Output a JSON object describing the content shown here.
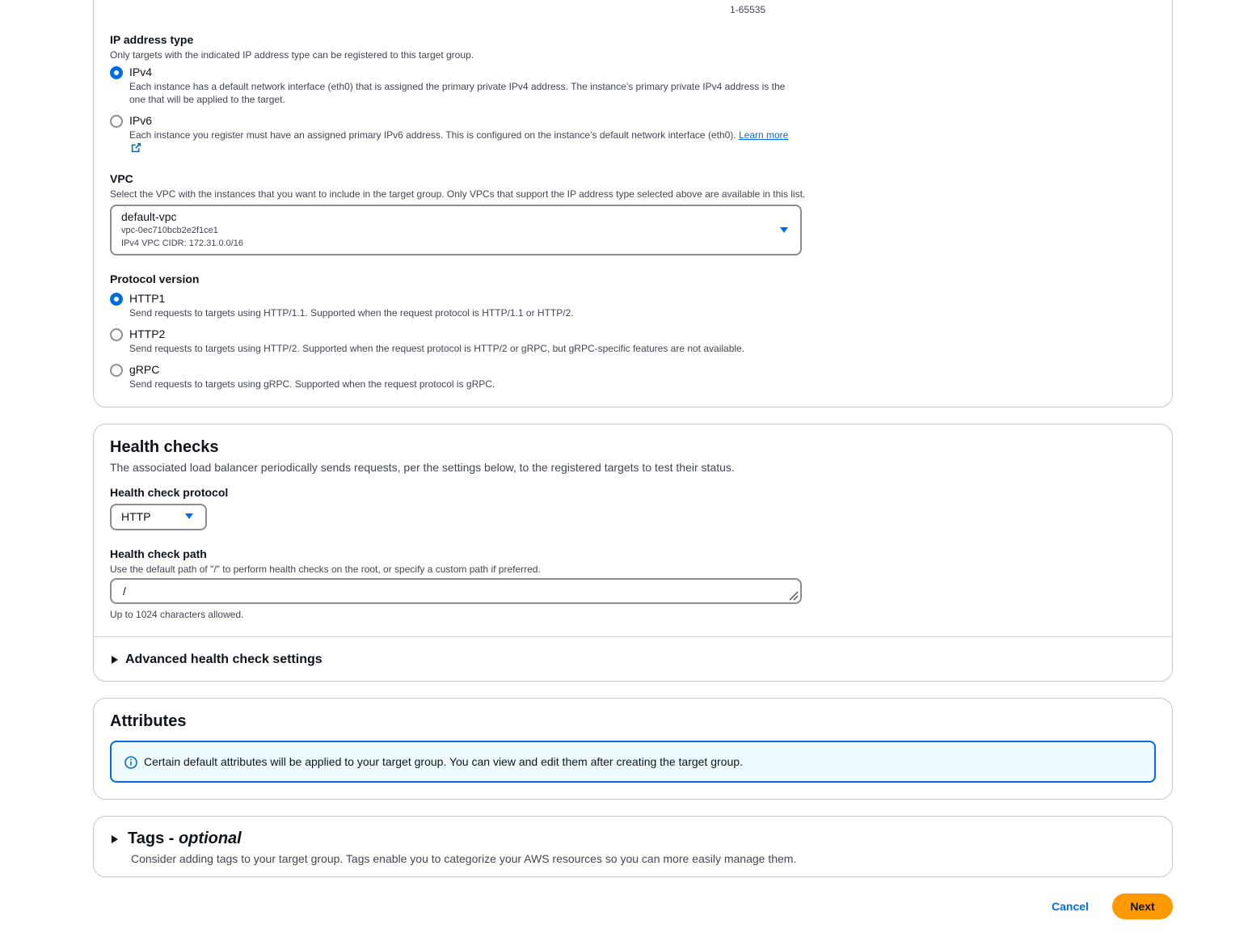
{
  "target_config": {
    "port_range_hint": "1-65535",
    "ip_address_type": {
      "label": "IP address type",
      "description": "Only targets with the indicated IP address type can be registered to this target group.",
      "options": [
        {
          "label": "IPv4",
          "description": "Each instance has a default network interface (eth0) that is assigned the primary private IPv4 address. The instance’s primary private IPv4 address is the one that will be applied to the target.",
          "selected": true
        },
        {
          "label": "IPv6",
          "description": "Each instance you register must have an assigned primary IPv6 address. This is configured on the instance’s default network interface (eth0).",
          "link_text": "Learn more",
          "selected": false
        }
      ]
    },
    "vpc": {
      "label": "VPC",
      "description": "Select the VPC with the instances that you want to include in the target group. Only VPCs that support the IP address type selected above are available in this list.",
      "selected_name": "default-vpc",
      "selected_id": "vpc-0ec710bcb2e2f1ce1",
      "selected_cidr": "IPv4 VPC CIDR: 172.31.0.0/16"
    },
    "protocol_version": {
      "label": "Protocol version",
      "options": [
        {
          "label": "HTTP1",
          "description": "Send requests to targets using HTTP/1.1. Supported when the request protocol is HTTP/1.1 or HTTP/2.",
          "selected": true
        },
        {
          "label": "HTTP2",
          "description": "Send requests to targets using HTTP/2. Supported when the request protocol is HTTP/2 or gRPC, but gRPC-specific features are not available.",
          "selected": false
        },
        {
          "label": "gRPC",
          "description": "Send requests to targets using gRPC. Supported when the request protocol is gRPC.",
          "selected": false
        }
      ]
    }
  },
  "health_checks": {
    "title": "Health checks",
    "description": "The associated load balancer periodically sends requests, per the settings below, to the registered targets to test their status.",
    "protocol_label": "Health check protocol",
    "protocol_value": "HTTP",
    "path_label": "Health check path",
    "path_description": "Use the default path of \"/\" to perform health checks on the root, or specify a custom path if preferred.",
    "path_value": "/",
    "path_constraint": "Up to 1024 characters allowed.",
    "advanced_label": "Advanced health check settings"
  },
  "attributes": {
    "title": "Attributes",
    "info_text": "Certain default attributes will be applied to your target group. You can view and edit them after creating the target group."
  },
  "tags": {
    "title": "Tags - ",
    "title_optional": "optional",
    "description": "Consider adding tags to your target group. Tags enable you to categorize your AWS resources so you can more easily manage them."
  },
  "footer": {
    "cancel_label": "Cancel",
    "next_label": "Next"
  },
  "colors": {
    "accent": "#006ce0",
    "primary_button": "#ff9900",
    "border": "#c6c6cd"
  }
}
